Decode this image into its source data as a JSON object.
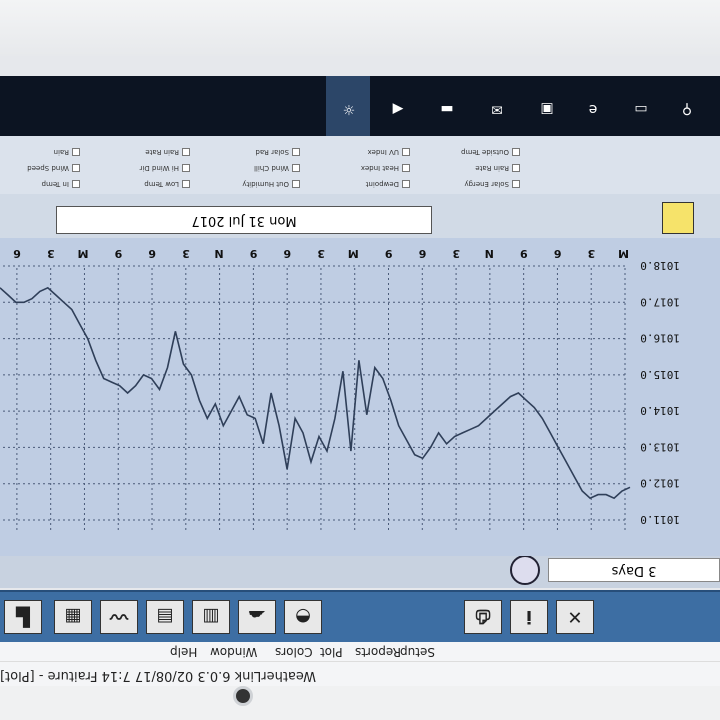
{
  "window": {
    "title": "WeatherLink 6.0.3  02/08/17  7:14 Fraiture - [Plot]"
  },
  "menu": [
    "Setup",
    "Reports",
    "Plot",
    "Colors",
    "Window",
    "Help"
  ],
  "toolbar_icons": [
    "station-icon",
    "weather-icon",
    "chart-icon",
    "bulletin-icon",
    "summary-icon",
    "noaa-icon",
    "cloud-icon",
    "vantage-icon",
    "print-icon",
    "info-icon",
    "close-icon"
  ],
  "plot": {
    "range_label": "3 Days",
    "date_label": "Mon 31 Jul 2017",
    "y_ticks": [
      "1011.0",
      "1012.0",
      "1013.0",
      "1014.0",
      "1015.0",
      "1016.0",
      "1017.0",
      "1018.0"
    ],
    "x_ticks": [
      "M",
      "3",
      "6",
      "9",
      "N",
      "3",
      "6",
      "9",
      "M",
      "3",
      "6",
      "9",
      "N",
      "3",
      "6",
      "9",
      "M",
      "3",
      "6"
    ]
  },
  "chart_data": {
    "type": "line",
    "title": "",
    "xlabel": "",
    "ylabel": "",
    "ylim": [
      1011.0,
      1018.0
    ],
    "y_axis": "inverted",
    "grid": true,
    "series": [
      {
        "values": [
          1011.9,
          1011.8,
          1011.6,
          1011.7,
          1011.7,
          1011.6,
          1011.8,
          1012.2,
          1012.6,
          1013.0,
          1013.4,
          1013.8,
          1014.1,
          1014.3,
          1014.5,
          1014.4,
          1014.2,
          1014.0,
          1013.8,
          1013.6,
          1013.5,
          1013.4,
          1013.3,
          1013.1,
          1013.4,
          1013.0,
          1012.7,
          1012.8,
          1013.2,
          1013.6,
          1014.3,
          1014.9,
          1015.2,
          1013.9,
          1015.4,
          1012.9,
          1015.1,
          1013.8,
          1012.9,
          1013.3,
          1012.6,
          1013.4,
          1013.8,
          1012.4,
          1013.6,
          1014.5,
          1013.1,
          1013.8,
          1013.9,
          1014.4,
          1014.0,
          1013.6,
          1014.2,
          1013.8,
          1014.3,
          1015.0,
          1015.3,
          1016.2,
          1015.2,
          1014.6,
          1014.9,
          1015.0,
          1014.7,
          1014.5,
          1014.7,
          1014.8,
          1014.9,
          1015.4,
          1016.0,
          1016.4,
          1016.8,
          1017.0,
          1017.2,
          1017.4,
          1017.3,
          1017.1,
          1017.0,
          1017.0,
          1017.2,
          1017.4
        ]
      }
    ]
  },
  "legend": [
    "In Temp",
    "Low Temp",
    "Out Humidity",
    "Dewpoint",
    "Solar Energy",
    "Wind Speed",
    "Hi Wind Dir",
    "Wind Chill",
    "Heat Index",
    "Rain Rate",
    "Rain",
    "Rain Rate",
    "Solar Rad",
    "UV Index",
    "Outside Temp"
  ],
  "taskbar_icons": [
    "search-icon",
    "task-view-icon",
    "edge-icon",
    "store-icon",
    "mail-icon",
    "cmd-icon",
    "weatherlink-icon"
  ]
}
